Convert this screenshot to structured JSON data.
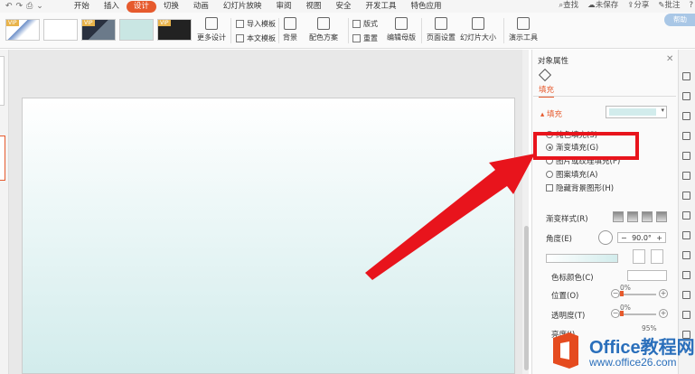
{
  "menu": {
    "tabs": [
      "开始",
      "插入",
      "设计",
      "切换",
      "动画",
      "幻灯片放映",
      "审阅",
      "视图",
      "安全",
      "开发工具",
      "特色应用"
    ],
    "active_tab": "设计",
    "search": "查找",
    "unsaved": "未保存",
    "share": "分享",
    "comment": "批注"
  },
  "ribbon": {
    "vip_label": "VIP",
    "more_design": "更多设计",
    "import_template": "导入模板",
    "this_template": "本文模板",
    "background": "背景",
    "color_scheme": "配色方案",
    "layout": "版式",
    "reset": "重置",
    "edit_master": "编辑母版",
    "page_setup": "页面设置",
    "slide_size": "幻灯片大小",
    "presentation_tools": "演示工具",
    "help_badge": "帮助"
  },
  "pane": {
    "title": "对象属性",
    "fill_tab": "填充",
    "fill_section": "填充",
    "fill_color": "#d2ecec",
    "options": [
      {
        "label": "纯色填充(S)",
        "checked": false
      },
      {
        "label": "渐变填充(G)",
        "checked": true
      },
      {
        "label": "图片或纹理填充(P)",
        "checked": false
      },
      {
        "label": "图案填充(A)",
        "checked": false
      }
    ],
    "hide_bg": "隐藏背景图形(H)",
    "gradient_style": "渐变样式(R)",
    "angle_label": "角度(E)",
    "angle_value": "90.0°",
    "stop_color": "色标颜色(C)",
    "position_label": "位置(O)",
    "position_value": "0%",
    "transparency_label": "透明度(T)",
    "transparency_value": "0%",
    "brightness_label": "亮度(I)",
    "brightness_value": "95%"
  },
  "watermark": {
    "line1": "Office教程网",
    "line2": "www.office26.com"
  },
  "colors": {
    "accent": "#e65a2d",
    "highlight": "#e8141c",
    "slide_gradient_end": "#d2ecec"
  }
}
